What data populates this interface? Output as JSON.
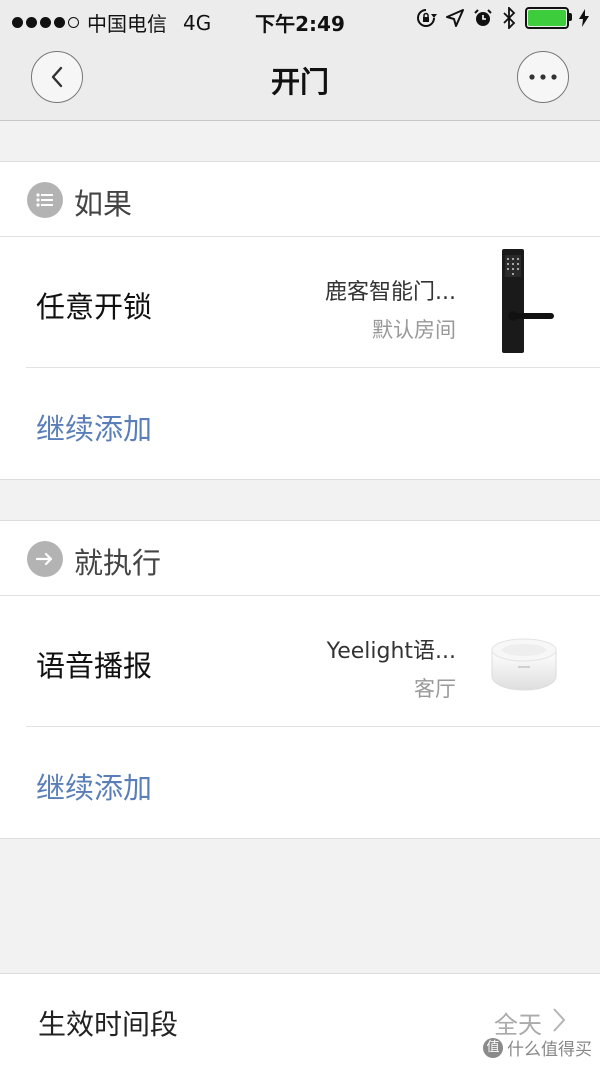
{
  "status_bar": {
    "carrier": "中国电信",
    "network": "4G",
    "time": "下午2:49"
  },
  "nav": {
    "title": "开门"
  },
  "if_section": {
    "title": "如果",
    "trigger": {
      "label": "任意开锁",
      "device_name": "鹿客智能门...",
      "device_room": "默认房间"
    },
    "add_more": "继续添加"
  },
  "then_section": {
    "title": "就执行",
    "action": {
      "label": "语音播报",
      "device_name": "Yeelight语...",
      "device_room": "客厅"
    },
    "add_more": "继续添加"
  },
  "period": {
    "label": "生效时间段",
    "value": "全天"
  },
  "watermark": {
    "text": "什么值得买",
    "logo_text": "值"
  },
  "colors": {
    "link": "#5a7fb8",
    "battery": "#3ccc3c"
  }
}
